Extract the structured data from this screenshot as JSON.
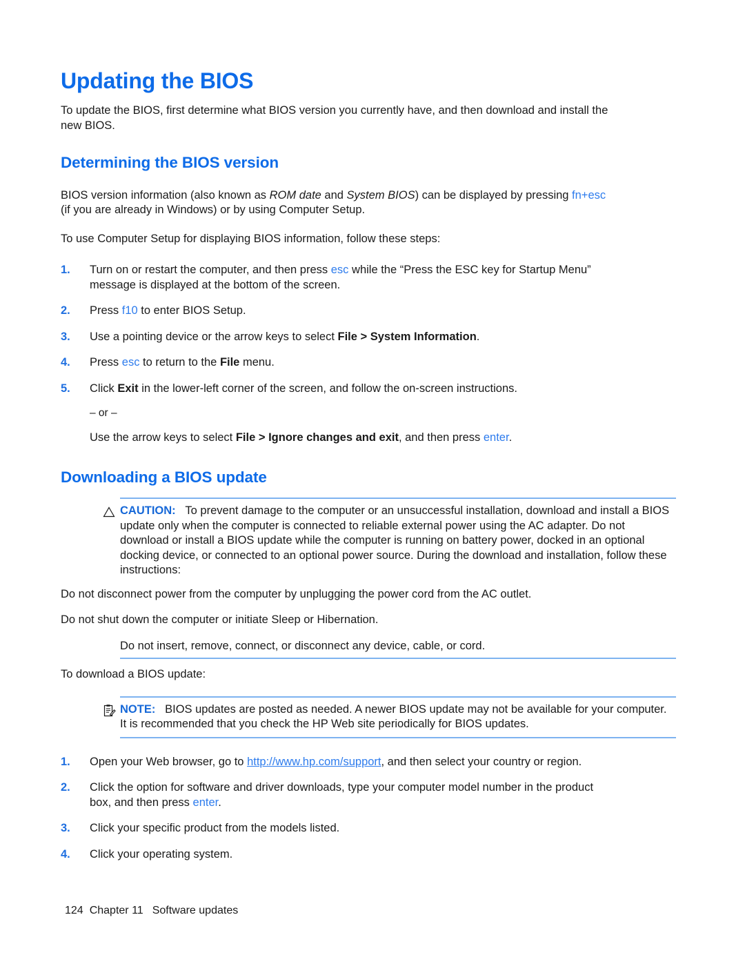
{
  "document": {
    "title": "Updating the BIOS",
    "intro": "To update the BIOS, first determine what BIOS version you currently have, and then download and install the new BIOS."
  },
  "colors": {
    "heading_blue": "#0d6be8",
    "key_blue": "#2e7ced",
    "list_number_blue": "#1f6fe0",
    "rule_blue": "#7eb3f0",
    "admonition_label_blue": "#1668d8",
    "body_black": "#1a1a1a"
  },
  "sections": [
    {
      "heading": "Determining the BIOS version",
      "para_1": {
        "part_1": "BIOS version information (also known as ",
        "italic_1": "ROM date",
        "part_2": " and ",
        "italic_2": "System BIOS",
        "part_3": ") can be displayed by pressing ",
        "key_1": "fn+esc",
        "part_4": " (if you are already in Windows) or by using Computer Setup."
      },
      "para_2": "To use Computer Setup for displaying BIOS information, follow these steps:",
      "steps": [
        {
          "number": "1.",
          "segments": [
            {
              "type": "text",
              "value": "Turn on or restart the computer, and then press "
            },
            {
              "type": "key",
              "value": "esc"
            },
            {
              "type": "text",
              "value": " while the “Press the ESC key for Startup Menu” message is displayed at the bottom of the screen."
            }
          ]
        },
        {
          "number": "2.",
          "segments": [
            {
              "type": "text",
              "value": "Press "
            },
            {
              "type": "key",
              "value": "f10"
            },
            {
              "type": "text",
              "value": " to enter BIOS Setup."
            }
          ]
        },
        {
          "number": "3.",
          "segments": [
            {
              "type": "text",
              "value": "Use a pointing device or the arrow keys to select "
            },
            {
              "type": "bold",
              "value": "File > System Information"
            },
            {
              "type": "text",
              "value": "."
            }
          ]
        },
        {
          "number": "4.",
          "segments": [
            {
              "type": "text",
              "value": "Press "
            },
            {
              "type": "key",
              "value": "esc"
            },
            {
              "type": "text",
              "value": " to return to the "
            },
            {
              "type": "bold",
              "value": "File"
            },
            {
              "type": "text",
              "value": " menu."
            }
          ]
        },
        {
          "number": "5.",
          "segments": [
            {
              "type": "text",
              "value": "Click "
            },
            {
              "type": "bold",
              "value": "Exit"
            },
            {
              "type": "text",
              "value": " in the lower-left corner of the screen, and follow the on-screen instructions."
            }
          ],
          "or_divider": "– or –",
          "alternate_segments": [
            {
              "type": "text",
              "value": "Use the arrow keys to select "
            },
            {
              "type": "bold",
              "value": "File > Ignore changes and exit"
            },
            {
              "type": "text",
              "value": ", and then press "
            },
            {
              "type": "key",
              "value": "enter"
            },
            {
              "type": "text",
              "value": "."
            }
          ]
        }
      ]
    },
    {
      "heading": "Downloading a BIOS update",
      "caution": {
        "icon": "warning-triangle-icon",
        "label": "CAUTION:",
        "body": "To prevent damage to the computer or an unsuccessful installation, download and install a BIOS update only when the computer is connected to reliable external power using the AC adapter. Do not download or install a BIOS update while the computer is running on battery power, docked in an optional docking device, or connected to an optional power source. During the download and installation, follow these instructions:",
        "bullets": [
          "Do not disconnect power from the computer by unplugging the power cord from the AC outlet.",
          "Do not shut down the computer or initiate Sleep or Hibernation.",
          "Do not insert, remove, connect, or disconnect any device, cable, or cord."
        ]
      },
      "para_after_caution": "To download a BIOS update:",
      "note": {
        "icon": "note-clipboard-icon",
        "label": "NOTE:",
        "body": "BIOS updates are posted as needed. A newer BIOS update may not be available for your computer. It is recommended that you check the HP Web site periodically for BIOS updates."
      },
      "steps": [
        {
          "number": "1.",
          "segments": [
            {
              "type": "text",
              "value": "Open your Web browser, go to "
            },
            {
              "type": "link",
              "value": "http://www.hp.com/support"
            },
            {
              "type": "text",
              "value": ", and then select your country or region."
            }
          ]
        },
        {
          "number": "2.",
          "segments": [
            {
              "type": "text",
              "value": "Click the option for software and driver downloads, type your computer model number in the product box, and then press "
            },
            {
              "type": "key",
              "value": "enter"
            },
            {
              "type": "text",
              "value": "."
            }
          ]
        },
        {
          "number": "3.",
          "segments": [
            {
              "type": "text",
              "value": "Click your specific product from the models listed."
            }
          ]
        },
        {
          "number": "4.",
          "segments": [
            {
              "type": "text",
              "value": "Click your operating system."
            }
          ]
        }
      ]
    }
  ],
  "footer": {
    "page_number": "124",
    "chapter": "Chapter 11",
    "chapter_title": "Software updates"
  }
}
